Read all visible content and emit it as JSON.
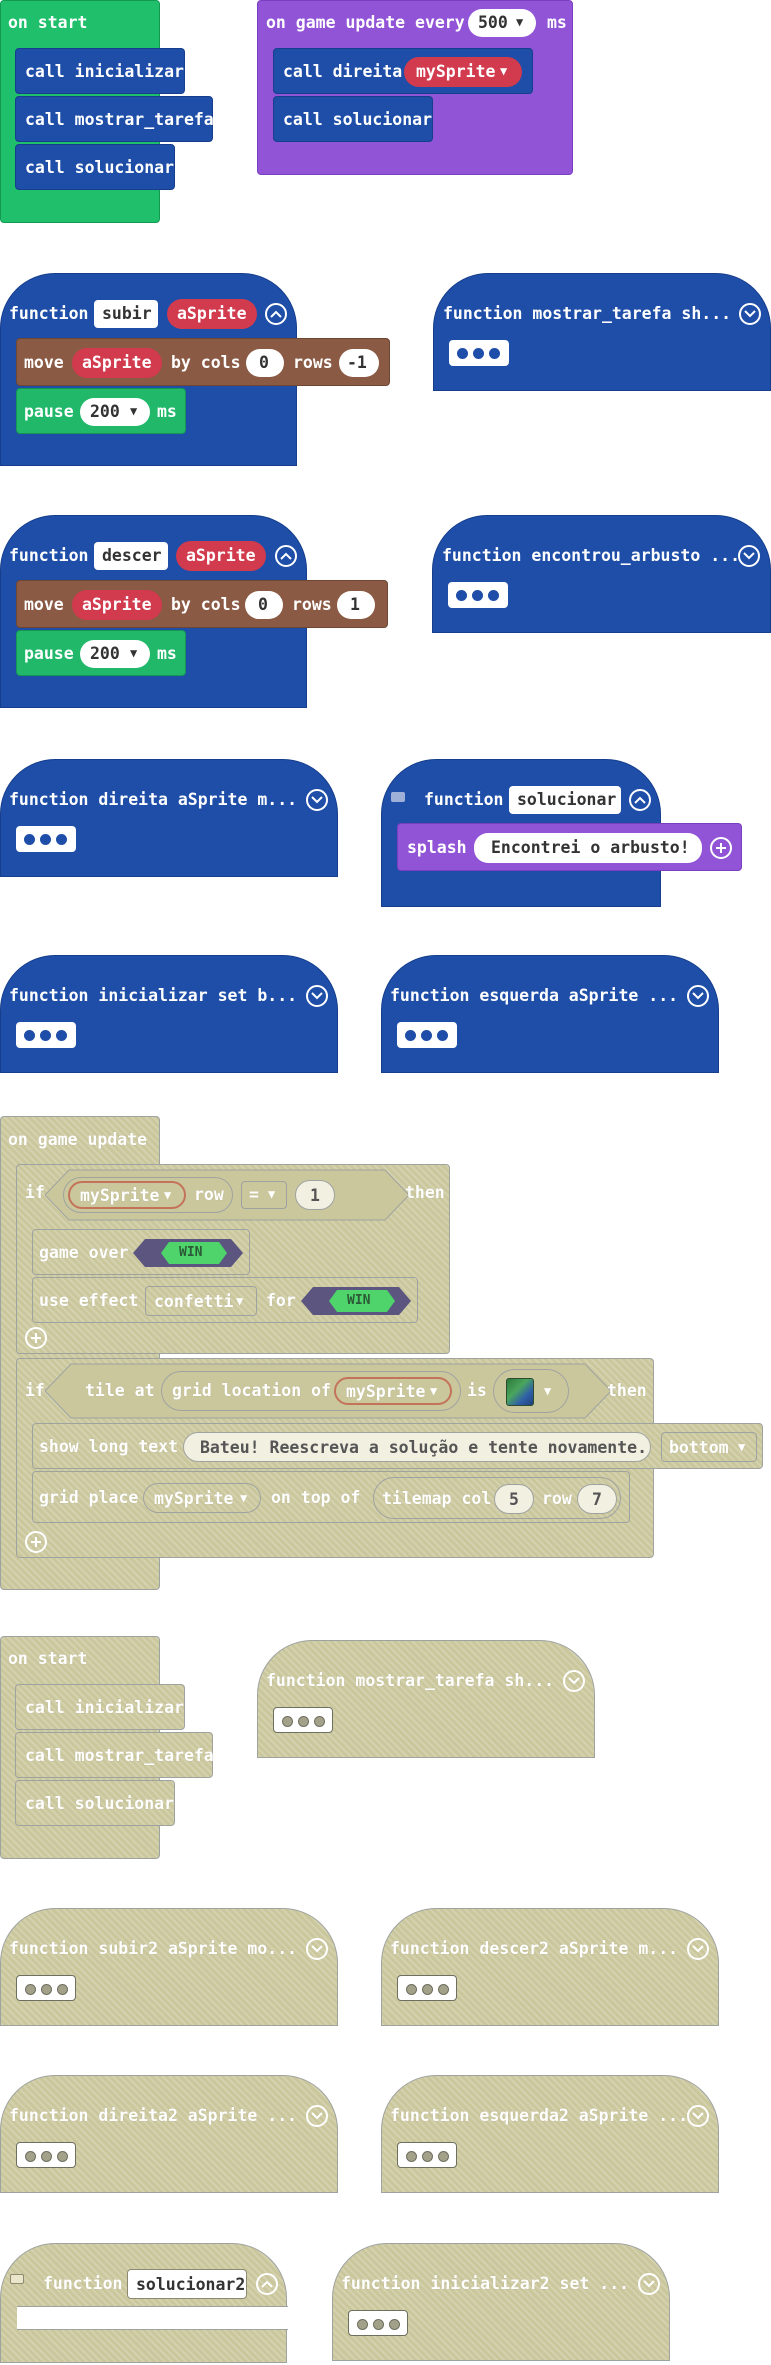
{
  "colors": {
    "events_green": "#1fbf6b",
    "loops_purple": "#9254d6",
    "functions_blue": "#1e4ea8",
    "sprites_brown": "#8a5a44",
    "pause_green": "#21b86a",
    "variable_red": "#d23a4e",
    "disabled_grey": "#cbc79d"
  },
  "on_start_1": {
    "header": "on start",
    "calls": [
      "call inicializar",
      "call mostrar_tarefa",
      "call solucionar"
    ]
  },
  "game_update_every": {
    "label_on": "on game update every",
    "interval": "500",
    "label_ms": "ms",
    "call_direita": "call direita",
    "sprite": "mySprite",
    "call_solucionar": "call solucionar"
  },
  "fn_subir": {
    "keyword": "function",
    "name": "subir",
    "param": "aSprite",
    "move": "move",
    "move_sprite": "aSprite",
    "by_cols": "by cols",
    "cols": "0",
    "rows_label": "rows",
    "rows": "-1",
    "pause": "pause",
    "pause_value": "200",
    "ms": "ms"
  },
  "fn_mostrar_tarefa": {
    "label": "function mostrar_tarefa  sh..."
  },
  "fn_descer": {
    "keyword": "function",
    "name": "descer",
    "param": "aSprite",
    "move": "move",
    "move_sprite": "aSprite",
    "by_cols": "by cols",
    "cols": "0",
    "rows_label": "rows",
    "rows": "1",
    "pause": "pause",
    "pause_value": "200",
    "ms": "ms"
  },
  "fn_encontrou_arbusto": {
    "label": "function encontrou_arbusto ..."
  },
  "fn_direita": {
    "label": "function direita aSprite  m..."
  },
  "fn_solucionar": {
    "keyword": "function",
    "name": "solucionar",
    "splash": "splash",
    "message": "Encontrei o arbusto!"
  },
  "fn_inicializar": {
    "label": "function inicializar  set b..."
  },
  "fn_esquerda": {
    "label": "function esquerda aSprite  ..."
  },
  "game_update_disabled": {
    "header": "on game update",
    "if1": "if",
    "sprite1": "mySprite",
    "row": "row",
    "op": "=",
    "value": "1",
    "then1": "then",
    "game_over": "game over",
    "win1": "WIN",
    "use_effect": "use effect",
    "effect": "confetti",
    "for": "for",
    "win2": "WIN",
    "if2": "if",
    "tile_at": "tile at",
    "grid_location_of": "grid location of",
    "sprite2": "mySprite",
    "is": "is",
    "then2": "then",
    "show_long_text": "show long text",
    "long_text": "Bateu! Reescreva a solução e tente novamente.",
    "position": "bottom",
    "grid_place": "grid place",
    "sprite3": "mySprite",
    "on_top_of": "on top of",
    "tilemap_col": "tilemap col",
    "col": "5",
    "row_label": "row",
    "row_value": "7"
  },
  "on_start_2": {
    "header": "on start",
    "calls": [
      "call inicializar",
      "call mostrar_tarefa",
      "call solucionar"
    ]
  },
  "fn_mostrar_tarefa_2": {
    "label": "function mostrar_tarefa  sh..."
  },
  "fn_subir2": {
    "label": "function subir2 aSprite  mo..."
  },
  "fn_descer2": {
    "label": "function descer2 aSprite  m..."
  },
  "fn_direita2": {
    "label": "function direita2 aSprite  ..."
  },
  "fn_esquerda2": {
    "label": "function esquerda2 aSprite ..."
  },
  "fn_solucionar2": {
    "keyword": "function",
    "name": "solucionar2"
  },
  "fn_inicializar2": {
    "label": "function inicializar2  set ..."
  },
  "icons": [
    "chevron-down-icon",
    "chevron-up-icon",
    "plus-icon",
    "comment-icon",
    "tile-image-icon",
    "dropdown-caret-icon"
  ]
}
